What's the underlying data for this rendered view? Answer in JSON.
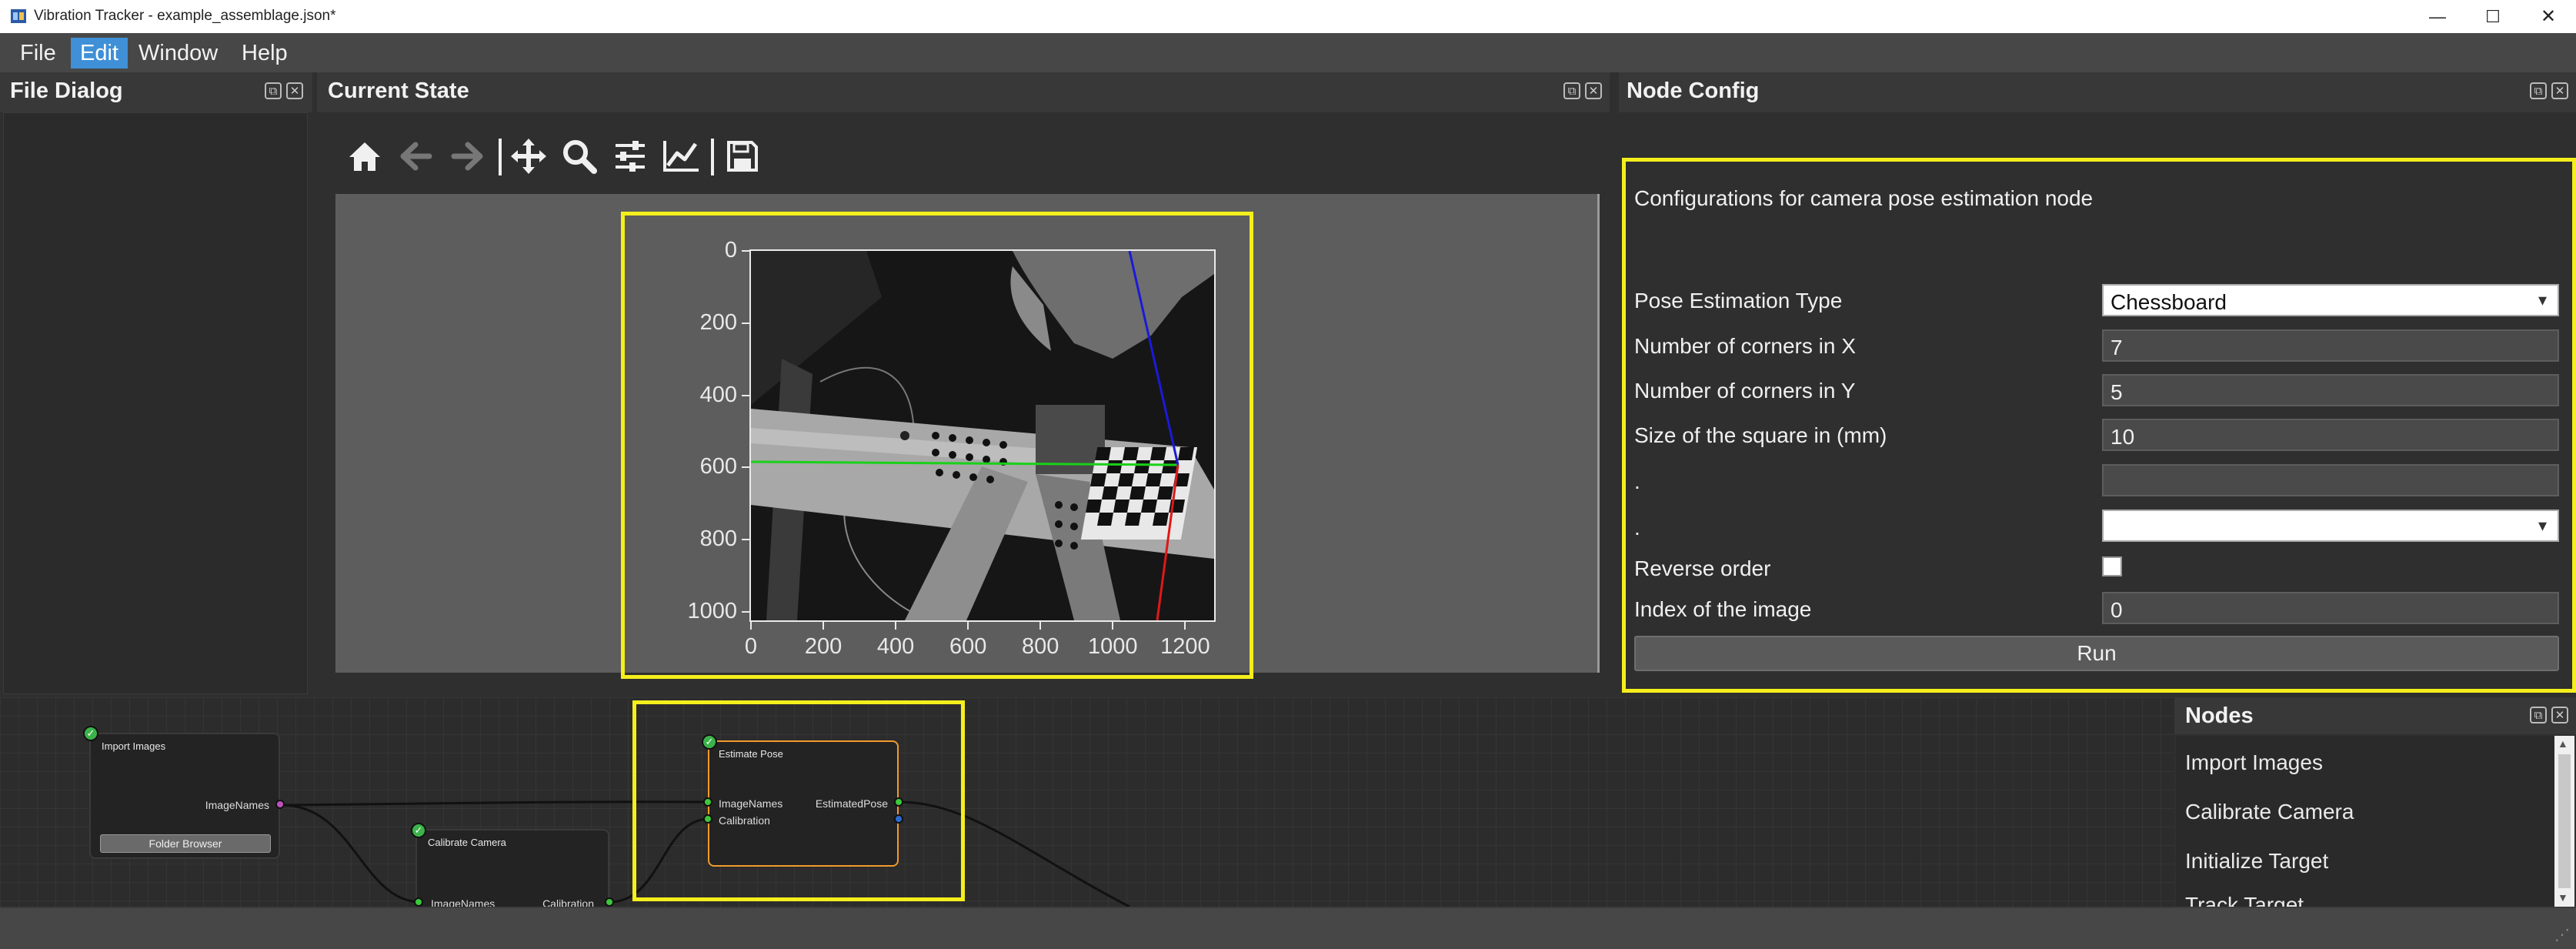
{
  "window": {
    "title": "Vibration Tracker - example_assemblage.json*",
    "minimize_glyph": "—",
    "maximize_glyph": "☐",
    "close_glyph": "✕"
  },
  "menu": [
    "File",
    "Edit",
    "Window",
    "Help"
  ],
  "panels": {
    "file_dialog": "File Dialog",
    "current_state": "Current State",
    "node_config": "Node Config",
    "nodes": "Nodes"
  },
  "toolbar_icons": [
    "home-icon",
    "back-icon",
    "forward-icon",
    "pan-icon",
    "zoom-icon",
    "configure-subplots-icon",
    "edit-axis-icon",
    "save-icon"
  ],
  "plot": {
    "x_ticks": [
      "0",
      "200",
      "400",
      "600",
      "800",
      "1000",
      "1200"
    ],
    "y_ticks": [
      "0",
      "200",
      "400",
      "600",
      "800",
      "1000"
    ]
  },
  "node_config": {
    "description": "Configurations for camera pose estimation node",
    "fields": [
      {
        "label": "Pose Estimation Type",
        "value": "Chessboard",
        "type": "select"
      },
      {
        "label": "Number of corners in X",
        "value": "7",
        "type": "text"
      },
      {
        "label": "Number of corners in Y",
        "value": "5",
        "type": "text"
      },
      {
        "label": "Size of the square in (mm)",
        "value": "10",
        "type": "text"
      },
      {
        "label": ".",
        "value": "",
        "type": "text"
      },
      {
        "label": ".",
        "value": "",
        "type": "select"
      },
      {
        "label": "Reverse order",
        "value": "",
        "type": "checkbox"
      },
      {
        "label": "Index of the image",
        "value": "0",
        "type": "text"
      }
    ],
    "run_label": "Run"
  },
  "graph": {
    "import_images": {
      "title": "Import Images",
      "out_port": "ImageNames",
      "button": "Folder Browser"
    },
    "calibrate_camera": {
      "title": "Calibrate Camera",
      "in_port": "ImageNames",
      "out_port": "Calibration"
    },
    "estimate_pose": {
      "title": "Estimate Pose",
      "in_ports": [
        "ImageNames",
        "Calibration"
      ],
      "out_port": "EstimatedPose"
    }
  },
  "nodes_list": [
    "Import Images",
    "Calibrate Camera",
    "Initialize Target",
    "Track Target"
  ],
  "colors": {
    "highlight": "#f4ef1c",
    "menu_active": "#3f90d7",
    "axis_green": "#19d119",
    "axis_blue": "#1a1ad8",
    "axis_red": "#e01818",
    "port_green": "#3cc83c",
    "port_purple": "#c050c0",
    "selected_node": "#f09a2a"
  }
}
